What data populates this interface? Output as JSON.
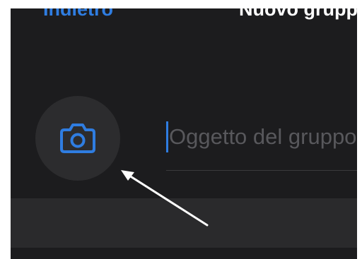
{
  "nav": {
    "back_label": "Indietro",
    "title": "Nuovo gruppo"
  },
  "group_photo": {
    "icon": "camera-icon"
  },
  "subject_field": {
    "placeholder": "Oggetto del gruppo",
    "value": ""
  },
  "colors": {
    "background": "#1c1c1e",
    "accent": "#2f7de1",
    "avatar_fill": "#2c2c2e",
    "placeholder": "#58585c",
    "annotation_arrow": "#ffffff"
  }
}
